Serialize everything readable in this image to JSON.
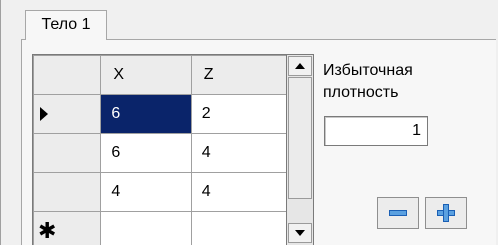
{
  "tabs": [
    {
      "label": "Тело 1",
      "active": true
    }
  ],
  "grid": {
    "columns": [
      "X",
      "Z"
    ],
    "rows": [
      {
        "x": "6",
        "z": "2",
        "current": true
      },
      {
        "x": "6",
        "z": "4",
        "current": false
      },
      {
        "x": "4",
        "z": "4",
        "current": false
      }
    ],
    "selected_cell": {
      "row": 0,
      "column": "X"
    },
    "new_row_marker": "✱"
  },
  "density": {
    "label": "Избыточная плотность",
    "value": "1"
  },
  "buttons": {
    "remove_icon": "minus-icon",
    "add_icon": "plus-icon"
  },
  "colors": {
    "selection": "#0a246a",
    "icon_fill": "#5aa0e0"
  }
}
